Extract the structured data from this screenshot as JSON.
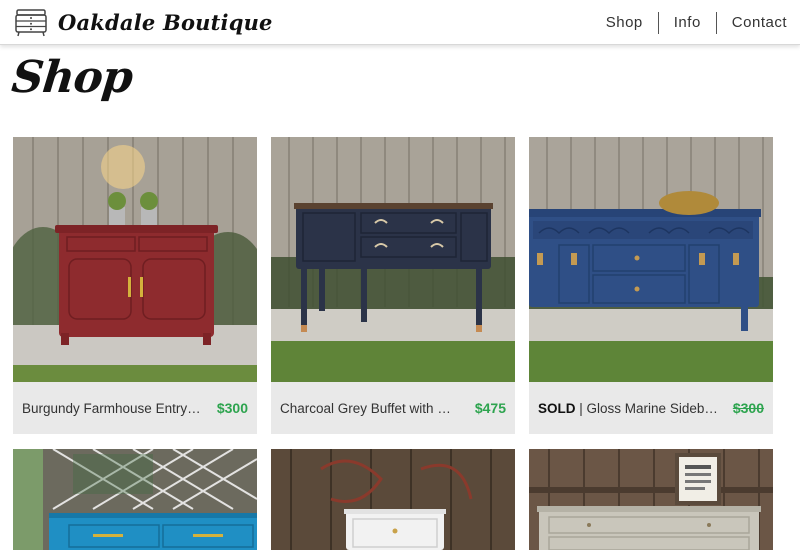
{
  "header": {
    "brand": "Oakdale Boutique",
    "logo_icon": "dresser-icon",
    "nav": [
      "Shop",
      "Info",
      "Contact"
    ]
  },
  "page": {
    "title": "Shop"
  },
  "products": [
    {
      "title": "Burgundy Farmhouse Entry…",
      "price": "$300",
      "sold": "",
      "color": "#8e2b2e"
    },
    {
      "title": "Charcoal Grey Buffet with …",
      "price": "$475",
      "sold": "",
      "color": "#2b3348"
    },
    {
      "title": "| Gloss Marine Sideb…",
      "price": "$300",
      "sold": "SOLD",
      "color": "#2f4f86"
    },
    {
      "title": "",
      "price": "",
      "sold": "",
      "color": "#1f8fc4"
    },
    {
      "title": "",
      "price": "",
      "sold": "",
      "color": "#f2f2f2"
    },
    {
      "title": "",
      "price": "",
      "sold": "",
      "color": "#c9c6bb"
    }
  ],
  "colors": {
    "price_green": "#2ea44f",
    "caption_bg": "#e9e9e9"
  }
}
